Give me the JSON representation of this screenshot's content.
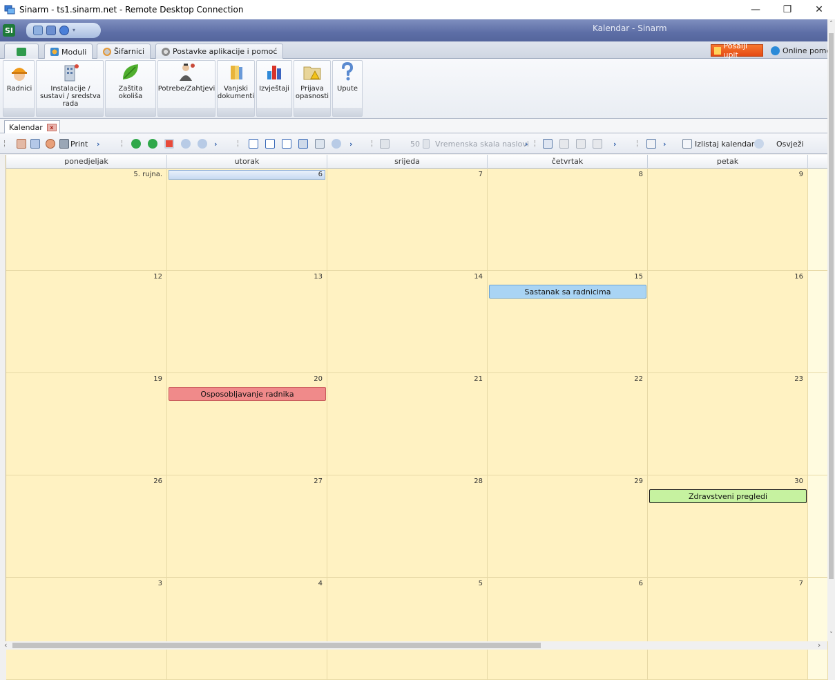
{
  "window": {
    "title": "Sinarm - ts1.sinarm.net - Remote Desktop Connection",
    "minimize": "—",
    "restore": "❐",
    "close": "✕"
  },
  "app": {
    "logo": "SI",
    "title": "Kalendar - Sinarm"
  },
  "ribbon_tabs": [
    {
      "label": "Moduli"
    },
    {
      "label": "Šifarnici"
    },
    {
      "label": "Postavke aplikacije i pomoć"
    }
  ],
  "ribbon_right": {
    "send_query": "Pošalji upit",
    "online_help": "Online pomoć"
  },
  "ribbon_buttons": [
    {
      "label": "Radnici",
      "icon": "worker-helmet-icon"
    },
    {
      "label": "Instalacije / sustavi / sredstva rada",
      "icon": "building-icon"
    },
    {
      "label": "Zaštita okoliša",
      "icon": "leaf-icon"
    },
    {
      "label": "Potrebe/Zahtjevi",
      "icon": "person-request-icon"
    },
    {
      "label": "Vanjski dokumenti",
      "icon": "books-icon"
    },
    {
      "label": "Izvještaji",
      "icon": "bar-chart-icon"
    },
    {
      "label": "Prijava opasnosti",
      "icon": "warning-folder-icon"
    },
    {
      "label": "Upute",
      "icon": "question-icon"
    }
  ],
  "doc_tab": {
    "label": "Kalendar",
    "close": "x"
  },
  "toolbar": {
    "print": "Print",
    "scale_value": "50",
    "time_scale": "Vremenska skala naslovi",
    "list_calendar": "Izlistaj kalendar",
    "refresh": "Osvježi"
  },
  "calendar": {
    "days": [
      "ponedjeljak",
      "utorak",
      "srijeda",
      "četvrtak",
      "petak"
    ],
    "weeks": [
      [
        "5. rujna.",
        "6",
        "7",
        "8",
        "9"
      ],
      [
        "12",
        "13",
        "14",
        "15",
        "16"
      ],
      [
        "19",
        "20",
        "21",
        "22",
        "23"
      ],
      [
        "26",
        "27",
        "28",
        "29",
        "30"
      ],
      [
        "3",
        "4",
        "5",
        "6",
        "7"
      ]
    ],
    "appointments": [
      {
        "title": "Sastanak sa radnicima",
        "week": 1,
        "day": 3,
        "color": "#a9d4f4",
        "border": "#6aa3d4"
      },
      {
        "title": "Osposobljavanje radnika",
        "week": 2,
        "day": 1,
        "color": "#f08a8a",
        "border": "#c85a5a"
      },
      {
        "title": "Zdravstveni pregledi",
        "week": 3,
        "day": 4,
        "color": "#c6f2a0",
        "border": "#1a1a1a"
      }
    ]
  }
}
